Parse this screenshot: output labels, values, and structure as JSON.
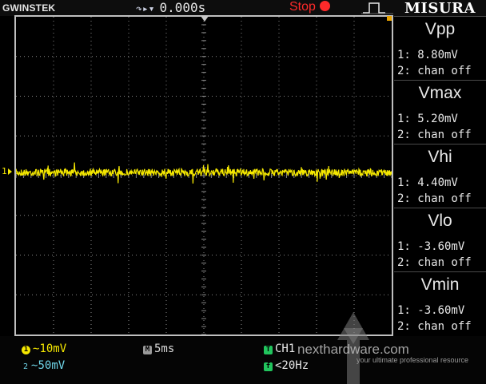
{
  "header": {
    "brand": "GWINSTEK",
    "trigger_time": "0.000s",
    "run_state": "Stop",
    "badge": "MISURA"
  },
  "measurements": [
    {
      "name": "Vpp",
      "ch1": "1: 8.80mV",
      "ch2": "2: chan off"
    },
    {
      "name": "Vmax",
      "ch1": "1: 5.20mV",
      "ch2": "2: chan off"
    },
    {
      "name": "Vhi",
      "ch1": "1: 4.40mV",
      "ch2": "2: chan off"
    },
    {
      "name": "Vlo",
      "ch1": "1: -3.60mV",
      "ch2": "2: chan off"
    },
    {
      "name": "Vmin",
      "ch1": "1: -3.60mV",
      "ch2": "2: chan off"
    }
  ],
  "footer": {
    "ch1_coupling_icon": "ac-coupling-icon",
    "ch1_scale": "10mV",
    "ch2_scale": "50mV",
    "timebase": "5ms",
    "trigger_source": "CH1",
    "trigger_freq": "<20Hz"
  },
  "watermark": {
    "site": "nexthardware.com",
    "tagline": "your ultimate professional resource"
  },
  "colors": {
    "ch1": "#f5e800",
    "ch2": "#6fd5e8",
    "stop": "#ff2a2a",
    "grid": "#8a8a8a"
  }
}
